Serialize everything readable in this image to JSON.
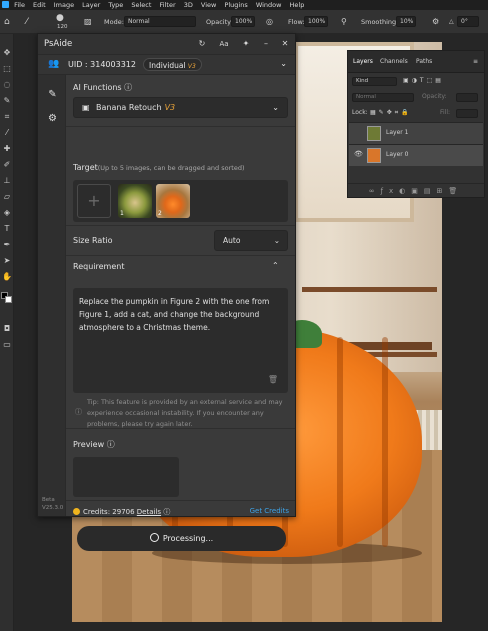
{
  "menubar": {
    "items": [
      "File",
      "Edit",
      "Image",
      "Layer",
      "Type",
      "Select",
      "Filter",
      "3D",
      "View",
      "Plugins",
      "Window",
      "Help"
    ]
  },
  "optionsbar": {
    "brush_size": "120",
    "mode_label": "Mode:",
    "mode_value": "Normal",
    "opacity_label": "Opacity:",
    "opacity_value": "100%",
    "flow_label": "Flow:",
    "flow_value": "100%",
    "smoothing_label": "Smoothing:",
    "smoothing_value": "10%",
    "angle_value": "0°"
  },
  "layers_panel": {
    "tabs": [
      "Layers",
      "Channels",
      "Paths"
    ],
    "filter_label": "Kind",
    "blend_mode": "Normal",
    "opacity_label": "Opacity:",
    "lock_label": "Lock:",
    "fill_label": "Fill:",
    "layers": [
      {
        "name": "Layer 1",
        "visible": false
      },
      {
        "name": "Layer 0",
        "visible": true
      }
    ]
  },
  "psaide": {
    "title": "PsAide",
    "uid_label": "UID : 314003312",
    "plan_badge": "Individual",
    "plan_version": "V3",
    "ai_functions_label": "AI Functions",
    "function_name": "Banana Retouch",
    "function_version": "V3",
    "target_label": "Target",
    "target_hint": "(Up to 5 images, can be dragged and sorted)",
    "target_images": [
      {
        "index": "1"
      },
      {
        "index": "2"
      }
    ],
    "size_ratio_label": "Size Ratio",
    "size_ratio_value": "Auto",
    "requirement_label": "Requirement",
    "requirement_text": "Replace the pumpkin in Figure 2 with the one from Figure 1, add a cat, and change the background atmosphere to a Christmas theme.",
    "tip_text": "Tip: This feature is provided by an external service and may experience occasional instability. If you encounter any problems, please try again later.",
    "preview_label": "Preview",
    "credits_label": "Credits: 29706",
    "details_label": "Details",
    "get_credits_label": "Get Credits",
    "processing_label": "Processing...",
    "beta_label": "Beta",
    "version_label": "V25.3.0",
    "accent_color": "#3ea3e6",
    "version_badge_color": "#e8a33a"
  }
}
